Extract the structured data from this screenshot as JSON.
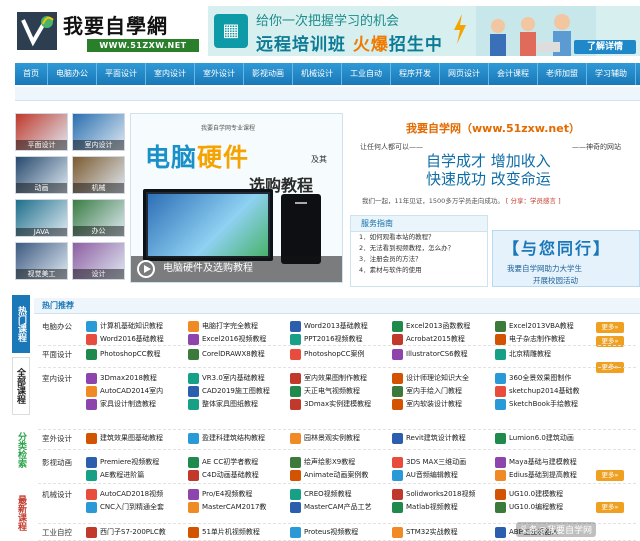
{
  "header": {
    "logo_text": "我要自學網",
    "logo_url": "WWW.51ZXW.NET",
    "banner_line1": "给你一次把握学习的机会",
    "banner_line2_a": "远程培训班",
    "banner_line2_b": "火爆",
    "banner_line2_c": "招生中",
    "banner_button": "了解详情"
  },
  "nav": {
    "items": [
      "首页",
      "电脑办公",
      "平面设计",
      "室内设计",
      "室外设计",
      "影视动画",
      "机械设计",
      "工业自动",
      "程序开发",
      "网页设计",
      "会计课程",
      "老师加盟",
      "学习辅助"
    ]
  },
  "thumbs": [
    "平面设计",
    "室内设计",
    "动画",
    "机械",
    "JAVA",
    "办公",
    "视觉美工",
    "设计"
  ],
  "slide": {
    "caption_top": "我要自学网专业课程",
    "title_a": "电脑",
    "title_b": "硬件",
    "title_small": "及其",
    "title_2": "选购教程",
    "caption": "电脑硬件及选购教程"
  },
  "promo": {
    "title": "我要自学网（www.51zxw.net）",
    "sub_left": "让任何人都可以——",
    "sub_right": "——神奇的网站",
    "big1": "自学成才  增加收入",
    "big2": "快速成功  改变命运",
    "foot": "我们一起，11年见证，1500多万学员走向成功。",
    "foot_link": "[ 分享：学员感言 ]"
  },
  "service": {
    "title": "服务指南",
    "items": [
      "1．如何观看本站的教程？",
      "2．无法看到视频教程，怎么办？",
      "3．注册会员的方法？",
      "4．素材与软件的使用"
    ]
  },
  "grow": {
    "title": "【与您同行】",
    "line1": "我要自学网助力大学生",
    "line2": "开展校园活动"
  },
  "vtabs": [
    "热门课程",
    "全部课程",
    "分类检索",
    "最新课程"
  ],
  "hot_title": "热门推荐",
  "more_label": "更多»",
  "categories": [
    {
      "name": "电脑办公",
      "courses": [
        "计算机基础知识教程",
        "电脑打字完全教程",
        "Word2013基础教程",
        "Excel2013函数教程",
        "Excel2013VBA教程",
        "Word2016基础教程",
        "Excel2016视频教程",
        "PPT2016视频教程",
        "Acrobat2015教程",
        "电子杂志制作教程"
      ]
    },
    {
      "name": "平面设计",
      "courses": [
        "PhotoshopCC教程",
        "CorelDRAWX8教程",
        "PhotoshopCC案例",
        "IllustratorCS6教程",
        "北京精雕教程"
      ]
    },
    {
      "name": "室内设计",
      "courses": [
        "3Dmax2018教程",
        "VR3.0室内基础教程",
        "室内效果图制作教程",
        "设计师理论知识大全",
        "360全景效果图制作",
        "AutoCAD2014室内",
        "CAD2019施工图教程",
        "天正电气视频教程",
        "室内手绘入门教程",
        "sketchup2014基础教",
        "家具设计制造教程",
        "整体家具图纸教程",
        "3Dmax实例建模教程",
        "室内软装设计教程",
        "SketchBook手绘教程"
      ]
    },
    {
      "name": "室外设计",
      "courses": [
        "建筑效果图基础教程",
        "盈建科建筑结构教程",
        "园林景观实例教程",
        "Revit建筑设计教程",
        "Lumion6.0建筑动画"
      ]
    },
    {
      "name": "影视动画",
      "courses": [
        "Premiere视频教程",
        "AE CC初学者教程",
        "绘声绘影X9教程",
        "3DS MAX三维动画",
        "Maya基础与建模教程",
        "AE教程进阶篇",
        "C4D动画基础教程",
        "Animate动画案例教",
        "AU音频编辑教程",
        "Edius基础到提高教程"
      ]
    },
    {
      "name": "机械设计",
      "courses": [
        "AutoCAD2018视频",
        "Pro/E4视频教程",
        "CREO视频教程",
        "Solidworks2018视频",
        "UG10.0建模教程",
        "CNC入门到精通全套",
        "MasterCAM2017教",
        "MasterCAM产品工艺",
        "Matlab视频教程",
        "UG10.0编程教程"
      ]
    },
    {
      "name": "工业自控",
      "courses": [
        "西门子S7-200PLC教",
        "51单片机视频教程",
        "Proteus视频教程",
        "STM32实战教程",
        "ABB工业机器人"
      ]
    }
  ],
  "watermark": "头条@我要自学网"
}
